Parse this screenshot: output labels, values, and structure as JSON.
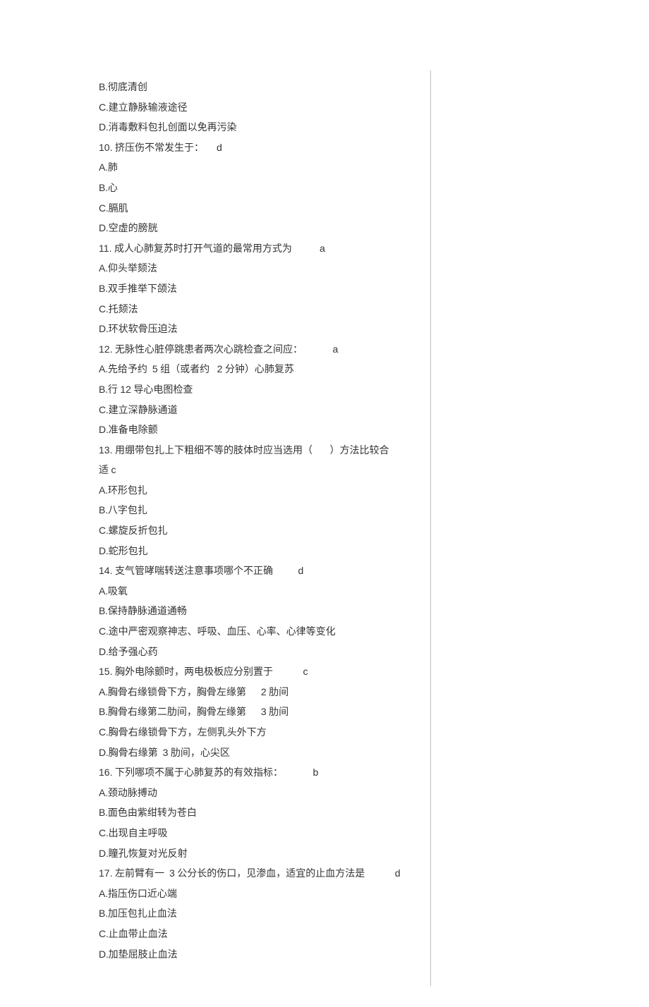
{
  "lines": [
    {
      "type": "opt",
      "letter": "B",
      "text": "彻底清创"
    },
    {
      "type": "opt",
      "letter": "C",
      "text": "建立静脉输液途径"
    },
    {
      "type": "opt",
      "letter": "D",
      "text": "消毒敷料包扎创面以免再污染"
    },
    {
      "type": "q",
      "num": "10.",
      "text": " 挤压伤不常发生于：",
      "ans": "d"
    },
    {
      "type": "opt",
      "letter": "A",
      "text": "肺"
    },
    {
      "type": "opt",
      "letter": "B",
      "text": "心"
    },
    {
      "type": "opt",
      "letter": "C",
      "text": "膈肌"
    },
    {
      "type": "opt",
      "letter": "D",
      "text": "空虚的膀胱"
    },
    {
      "type": "q",
      "num": "11.",
      "text": " 成人心肺复苏时打开气道的最常用方式为      ",
      "ans": "a"
    },
    {
      "type": "opt",
      "letter": "A",
      "text": "仰头举颏法"
    },
    {
      "type": "opt",
      "letter": "B",
      "text": "双手推举下颌法"
    },
    {
      "type": "opt",
      "letter": "C",
      "text": "托颏法"
    },
    {
      "type": "opt",
      "letter": "D",
      "text": "环状软骨压迫法"
    },
    {
      "type": "q",
      "num": "12.",
      "text": " 无脉性心脏停跳患者两次心跳检查之间应：       ",
      "ans": "a"
    },
    {
      "type": "mix",
      "parts": [
        {
          "t": "letter",
          "v": "A"
        },
        {
          "t": "plain",
          "v": ".先给予约  "
        },
        {
          "t": "num",
          "v": "5"
        },
        {
          "t": "plain",
          "v": " 组（或者约   "
        },
        {
          "t": "num",
          "v": "2"
        },
        {
          "t": "plain",
          "v": " 分钟）心肺复苏"
        }
      ]
    },
    {
      "type": "mix",
      "parts": [
        {
          "t": "letter",
          "v": "B"
        },
        {
          "t": "plain",
          "v": ".行 "
        },
        {
          "t": "num",
          "v": "12"
        },
        {
          "t": "plain",
          "v": " 导心电图检查"
        }
      ]
    },
    {
      "type": "opt",
      "letter": "C",
      "text": "建立深静脉通道"
    },
    {
      "type": "opt",
      "letter": "D",
      "text": "准备电除颤"
    },
    {
      "type": "q",
      "num": "13.",
      "text": " 用绷带包扎上下粗细不等的肢体时应当选用（       ）方法比较合",
      "ans": ""
    },
    {
      "type": "plainline",
      "text": "适 ",
      "ans": "c"
    },
    {
      "type": "opt",
      "letter": "A",
      "text": "环形包扎"
    },
    {
      "type": "opt",
      "letter": "B",
      "text": "八字包扎"
    },
    {
      "type": "opt",
      "letter": "C",
      "text": "螺旋反折包扎"
    },
    {
      "type": "opt",
      "letter": "D",
      "text": "蛇形包扎"
    },
    {
      "type": "q",
      "num": "14.",
      "text": " 支气管哮喘转送注意事项哪个不正确     ",
      "ans": "d"
    },
    {
      "type": "opt",
      "letter": "A",
      "text": "吸氧"
    },
    {
      "type": "opt",
      "letter": "B",
      "text": "保持静脉通道通畅"
    },
    {
      "type": "opt",
      "letter": "C",
      "text": "途中严密观察神志、呼吸、血压、心率、心律等变化"
    },
    {
      "type": "opt",
      "letter": "D",
      "text": "给予强心药"
    },
    {
      "type": "q",
      "num": "15.",
      "text": " 胸外电除颤时，两电极板应分别置于       ",
      "ans": "c"
    },
    {
      "type": "mix",
      "parts": [
        {
          "t": "letter",
          "v": "A"
        },
        {
          "t": "plain",
          "v": ".胸骨右缘锁骨下方，胸骨左缘第      "
        },
        {
          "t": "num",
          "v": "2"
        },
        {
          "t": "plain",
          "v": " 肋间"
        }
      ]
    },
    {
      "type": "mix",
      "parts": [
        {
          "t": "letter",
          "v": "B"
        },
        {
          "t": "plain",
          "v": ".胸骨右缘第二肋间，胸骨左缘第      "
        },
        {
          "t": "num",
          "v": "3"
        },
        {
          "t": "plain",
          "v": " 肋间"
        }
      ]
    },
    {
      "type": "opt",
      "letter": "C",
      "text": "胸骨右缘锁骨下方，左侧乳头外下方"
    },
    {
      "type": "mix",
      "parts": [
        {
          "t": "letter",
          "v": "D"
        },
        {
          "t": "plain",
          "v": ".胸骨右缘第  "
        },
        {
          "t": "num",
          "v": "3"
        },
        {
          "t": "plain",
          "v": " 肋间，心尖区"
        }
      ]
    },
    {
      "type": "q",
      "num": "16.",
      "text": " 下列哪项不属于心肺复苏的有效指标：       ",
      "ans": "b"
    },
    {
      "type": "opt",
      "letter": "A",
      "text": "颈动脉搏动"
    },
    {
      "type": "opt",
      "letter": "B",
      "text": "面色由紫绀转为苍白"
    },
    {
      "type": "opt",
      "letter": "C",
      "text": "出现自主呼吸"
    },
    {
      "type": "opt",
      "letter": "D",
      "text": "瞳孔恢复对光反射"
    },
    {
      "type": "q17",
      "num": "17.",
      "pre": " 左前臂有一  ",
      "mid_num": "3",
      "post": " 公分长的伤口，见渗血，适宜的止血方法是       ",
      "ans": "d"
    },
    {
      "type": "opt",
      "letter": "A",
      "text": "指压伤口近心端"
    },
    {
      "type": "opt",
      "letter": "B",
      "text": "加压包扎止血法"
    },
    {
      "type": "opt",
      "letter": "C",
      "text": "止血带止血法"
    },
    {
      "type": "opt",
      "letter": "D",
      "text": "加垫屈肢止血法"
    }
  ]
}
